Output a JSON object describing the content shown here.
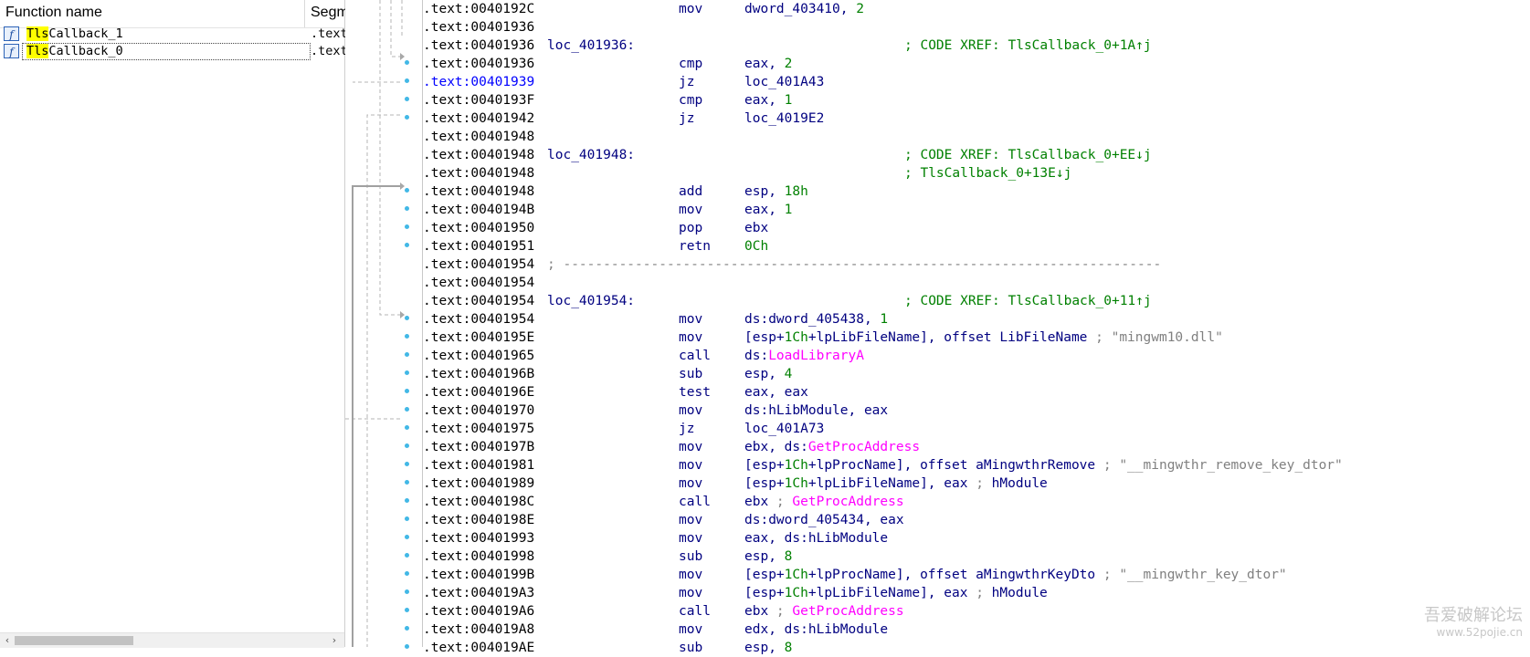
{
  "functions_window": {
    "columns": [
      "Function name",
      "Segm"
    ],
    "rows": [
      {
        "name_highlight": "Tls",
        "name_rest": "Callback_1",
        "segment": ".text"
      },
      {
        "name_highlight": "Tls",
        "name_rest": "Callback_0",
        "segment": ".text"
      }
    ],
    "icon_glyph": "f"
  },
  "disassembly": {
    "segment_prefix": ".text:",
    "selected_row": 4,
    "lines": [
      {
        "addr": "0040192C",
        "mnem": "mov",
        "ops": "dword_403410, 2"
      },
      {
        "addr": "00401936"
      },
      {
        "addr": "00401936",
        "label": "loc_401936:",
        "xref": "; CODE XREF: TlsCallback_0+1A↑j"
      },
      {
        "addr": "00401936",
        "mnem": "cmp",
        "ops": "eax, 2"
      },
      {
        "addr": "00401939",
        "mnem": "jz",
        "ops": "loc_401A43"
      },
      {
        "addr": "0040193F",
        "mnem": "cmp",
        "ops": "eax, 1"
      },
      {
        "addr": "00401942",
        "mnem": "jz",
        "ops": "loc_4019E2"
      },
      {
        "addr": "00401948"
      },
      {
        "addr": "00401948",
        "label": "loc_401948:",
        "xref": "; CODE XREF: TlsCallback_0+EE↓j"
      },
      {
        "addr": "00401948",
        "xref": "; TlsCallback_0+13E↓j"
      },
      {
        "addr": "00401948",
        "mnem": "add",
        "ops": "esp, 18h"
      },
      {
        "addr": "0040194B",
        "mnem": "mov",
        "ops": "eax, 1"
      },
      {
        "addr": "00401950",
        "mnem": "pop",
        "ops": "ebx"
      },
      {
        "addr": "00401951",
        "mnem": "retn",
        "ops": "0Ch"
      },
      {
        "addr": "00401954",
        "separator": "; ---------------------------------------------------------------------------"
      },
      {
        "addr": "00401954"
      },
      {
        "addr": "00401954",
        "label": "loc_401954:",
        "xref": "; CODE XREF: TlsCallback_0+11↑j"
      },
      {
        "addr": "00401954",
        "mnem": "mov",
        "ops": "ds:dword_405438, 1"
      },
      {
        "addr": "0040195E",
        "mnem": "mov",
        "ops": "[esp+1Ch+lpLibFileName], offset LibFileName",
        "comment": "; \"mingwm10.dll\""
      },
      {
        "addr": "00401965",
        "mnem": "call",
        "ops": "ds:LoadLibraryA"
      },
      {
        "addr": "0040196B",
        "mnem": "sub",
        "ops": "esp, 4"
      },
      {
        "addr": "0040196E",
        "mnem": "test",
        "ops": "eax, eax"
      },
      {
        "addr": "00401970",
        "mnem": "mov",
        "ops": "ds:hLibModule, eax"
      },
      {
        "addr": "00401975",
        "mnem": "jz",
        "ops": "loc_401A73"
      },
      {
        "addr": "0040197B",
        "mnem": "mov",
        "ops": "ebx, ds:GetProcAddress"
      },
      {
        "addr": "00401981",
        "mnem": "mov",
        "ops": "[esp+1Ch+lpProcName], offset aMingwthrRemove",
        "comment": "; \"__mingwthr_remove_key_dtor\""
      },
      {
        "addr": "00401989",
        "mnem": "mov",
        "ops": "[esp+1Ch+lpLibFileName], eax ; hModule"
      },
      {
        "addr": "0040198C",
        "mnem": "call",
        "ops": "ebx ; GetProcAddress"
      },
      {
        "addr": "0040198E",
        "mnem": "mov",
        "ops": "ds:dword_405434, eax"
      },
      {
        "addr": "00401993",
        "mnem": "mov",
        "ops": "eax, ds:hLibModule"
      },
      {
        "addr": "00401998",
        "mnem": "sub",
        "ops": "esp, 8"
      },
      {
        "addr": "0040199B",
        "mnem": "mov",
        "ops": "[esp+1Ch+lpProcName], offset aMingwthrKeyDto",
        "comment": "; \"__mingwthr_key_dtor\""
      },
      {
        "addr": "004019A3",
        "mnem": "mov",
        "ops": "[esp+1Ch+lpLibFileName], eax ; hModule"
      },
      {
        "addr": "004019A6",
        "mnem": "call",
        "ops": "ebx ; GetProcAddress"
      },
      {
        "addr": "004019A8",
        "mnem": "mov",
        "ops": "edx, ds:hLibModule"
      },
      {
        "addr": "004019AE",
        "mnem": "sub",
        "ops": "esp, 8"
      }
    ]
  },
  "watermark": {
    "text": "吾爱破解论坛",
    "url": "www.52pojie.cn"
  },
  "colors": {
    "address": "#000080",
    "selected_address": "#0000ff",
    "xref": "#008000",
    "api": "#ff00ff",
    "comment": "#808080",
    "arrow_dot": "#42b8e6",
    "highlight": "#ffff00"
  }
}
